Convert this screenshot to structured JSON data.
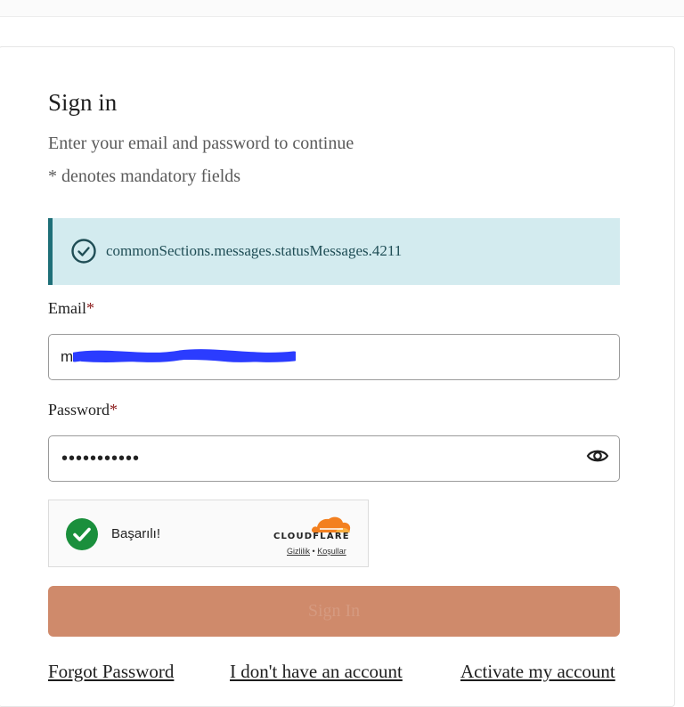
{
  "form": {
    "title": "Sign in",
    "subtitle": "Enter your email and password to continue",
    "mandatory_note": "* denotes mandatory fields",
    "alert_message": "commonSections.messages.statusMessages.4211",
    "email_label": "Email",
    "email_first_char": "m",
    "password_label": "Password",
    "password_value": "•••••••••••",
    "required_marker": "*",
    "submit_label": "Sign In"
  },
  "captcha": {
    "status_text": "Başarılı!",
    "brand": "CLOUDFLARE",
    "privacy_link": "Gizlilik",
    "separator": "•",
    "terms_link": "Koşullar"
  },
  "links": {
    "forgot_password": "Forgot Password",
    "no_account": "I don't have an account",
    "activate": "Activate my account"
  },
  "colors": {
    "alert_bg": "#d3ebef",
    "alert_border": "#1e6f78",
    "button_bg": "#cf8a6b",
    "captcha_success": "#1a8f3c",
    "cloudflare_orange": "#f38020",
    "required_marker": "#8b1a1a"
  },
  "icons": {
    "alert": "check-circle-icon",
    "password_toggle": "eye-icon",
    "captcha_status": "check-circle-filled-icon",
    "captcha_brand": "cloudflare-cloud-icon"
  }
}
